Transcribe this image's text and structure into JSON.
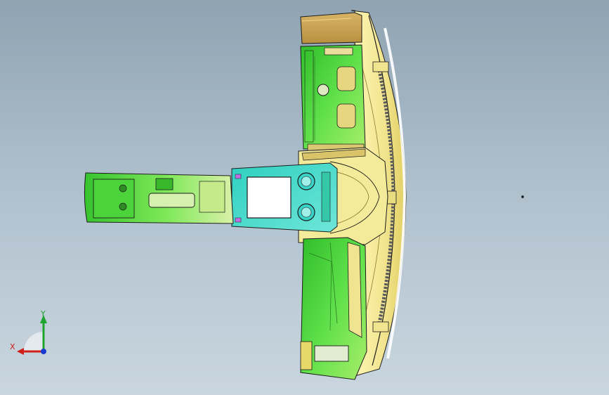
{
  "triad": {
    "x_label": "X",
    "y_label": "Y",
    "x_color": "#d0201a",
    "y_color": "#1fa32e",
    "z_color": "#1a3bd0"
  },
  "viewport": {
    "background_top": "#8fa3b2",
    "background_bottom": "#c9d6df",
    "model_colors": {
      "dashboard": "#f3ea9a",
      "console": "#3fd13a",
      "console_center": "#3fd3c8",
      "trim_accent": "#c9a85a",
      "edges": "#1c1c1c"
    }
  }
}
